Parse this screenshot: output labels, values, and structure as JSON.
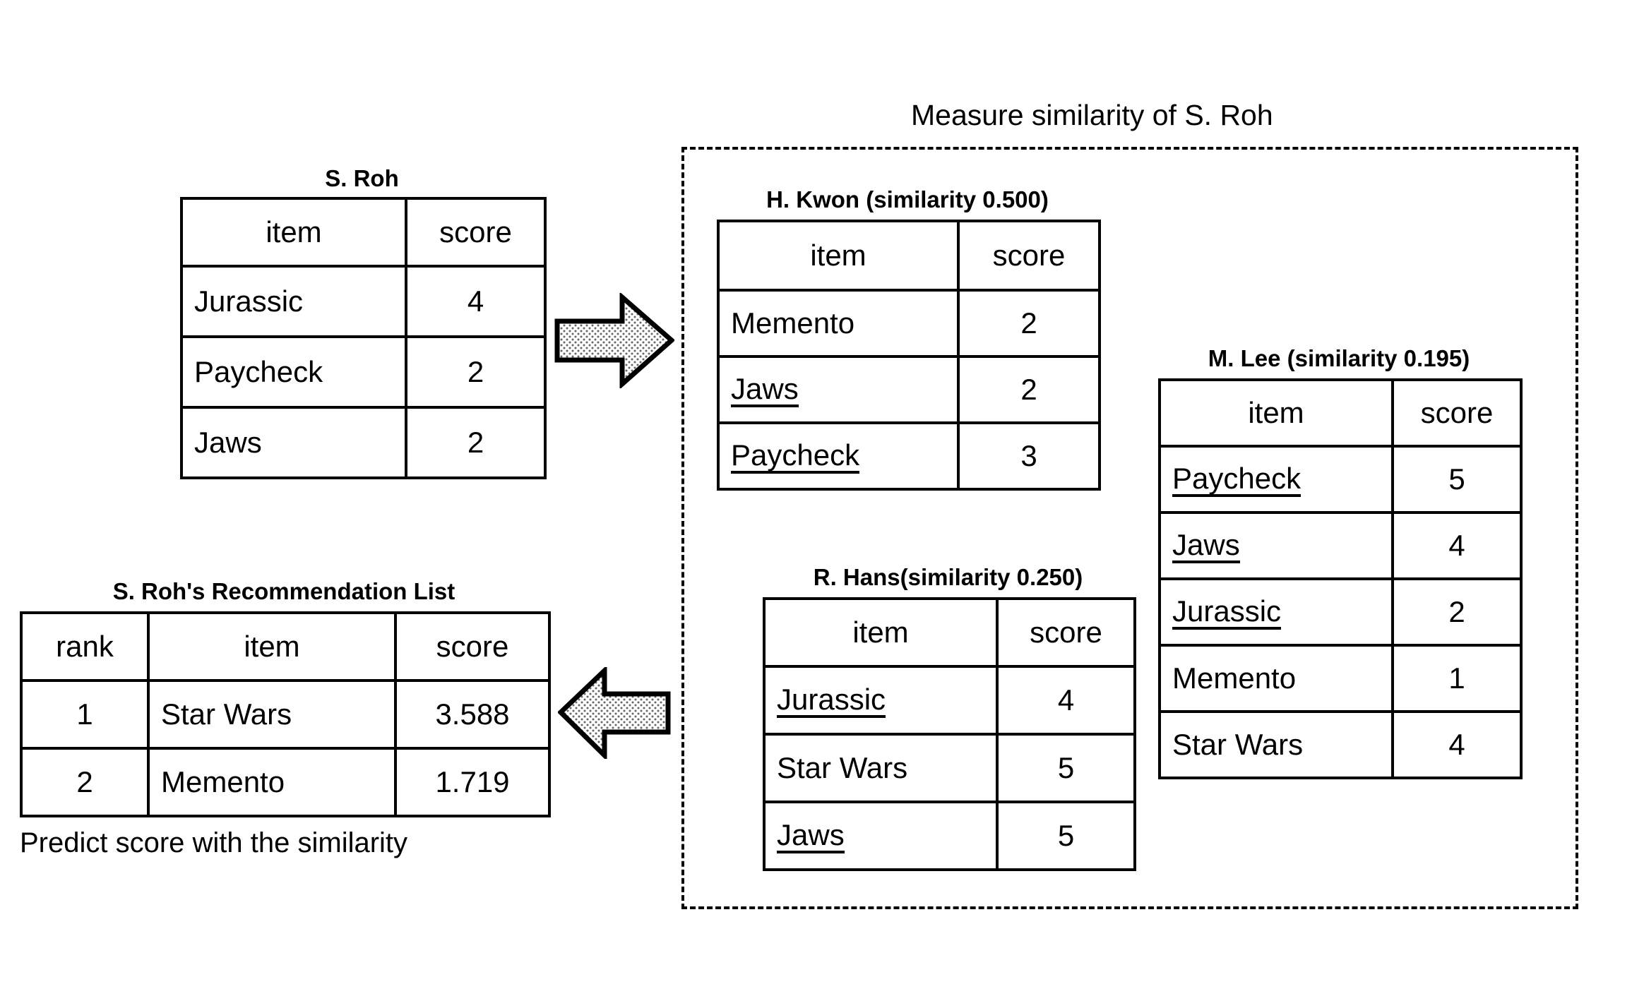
{
  "diagram": {
    "group_title": "Measure similarity of S. Roh",
    "footer_note": "Predict score with the similarity"
  },
  "source_user_table": {
    "title": "S. Roh",
    "headers": [
      "item",
      "score"
    ],
    "rows": [
      {
        "item": "Jurassic",
        "score": "4",
        "highlight": false
      },
      {
        "item": "Paycheck",
        "score": "2",
        "highlight": false
      },
      {
        "item": "Jaws",
        "score": "2",
        "highlight": false
      }
    ]
  },
  "recommendation_table": {
    "title": "S. Roh's Recommendation List",
    "headers": [
      "rank",
      "item",
      "score"
    ],
    "rows": [
      {
        "rank": "1",
        "item": "Star Wars",
        "score": "3.588"
      },
      {
        "rank": "2",
        "item": "Memento",
        "score": "1.719"
      }
    ]
  },
  "neighbors": [
    {
      "title": "H. Kwon (similarity 0.500)",
      "name": "H. Kwon",
      "similarity": "0.500",
      "headers": [
        "item",
        "score"
      ],
      "rows": [
        {
          "item": "Memento",
          "score": "2",
          "highlight": false
        },
        {
          "item": "Jaws",
          "score": "2",
          "highlight": true
        },
        {
          "item": "Paycheck",
          "score": "3",
          "highlight": true
        }
      ]
    },
    {
      "title": "R. Hans(similarity 0.250)",
      "name": "R. Hans",
      "similarity": "0.250",
      "headers": [
        "item",
        "score"
      ],
      "rows": [
        {
          "item": "Jurassic",
          "score": "4",
          "highlight": true
        },
        {
          "item": "Star Wars",
          "score": "5",
          "highlight": false
        },
        {
          "item": "Jaws",
          "score": "5",
          "highlight": true
        }
      ]
    },
    {
      "title": "M. Lee (similarity 0.195)",
      "name": "M. Lee",
      "similarity": "0.195",
      "headers": [
        "item",
        "score"
      ],
      "rows": [
        {
          "item": "Paycheck",
          "score": "5",
          "highlight": true
        },
        {
          "item": "Jaws",
          "score": "4",
          "highlight": true
        },
        {
          "item": "Jurassic",
          "score": "2",
          "highlight": true
        },
        {
          "item": "Memento",
          "score": "1",
          "highlight": false
        },
        {
          "item": "Star Wars",
          "score": "4",
          "highlight": false
        }
      ]
    }
  ],
  "arrows": [
    {
      "name": "arrow-right-to-neighbors",
      "direction": "right"
    },
    {
      "name": "arrow-left-to-recommendation",
      "direction": "left"
    }
  ],
  "colors": {
    "stroke": "#000000",
    "background": "#ffffff",
    "arrow_fill": "#d8d8d8"
  }
}
